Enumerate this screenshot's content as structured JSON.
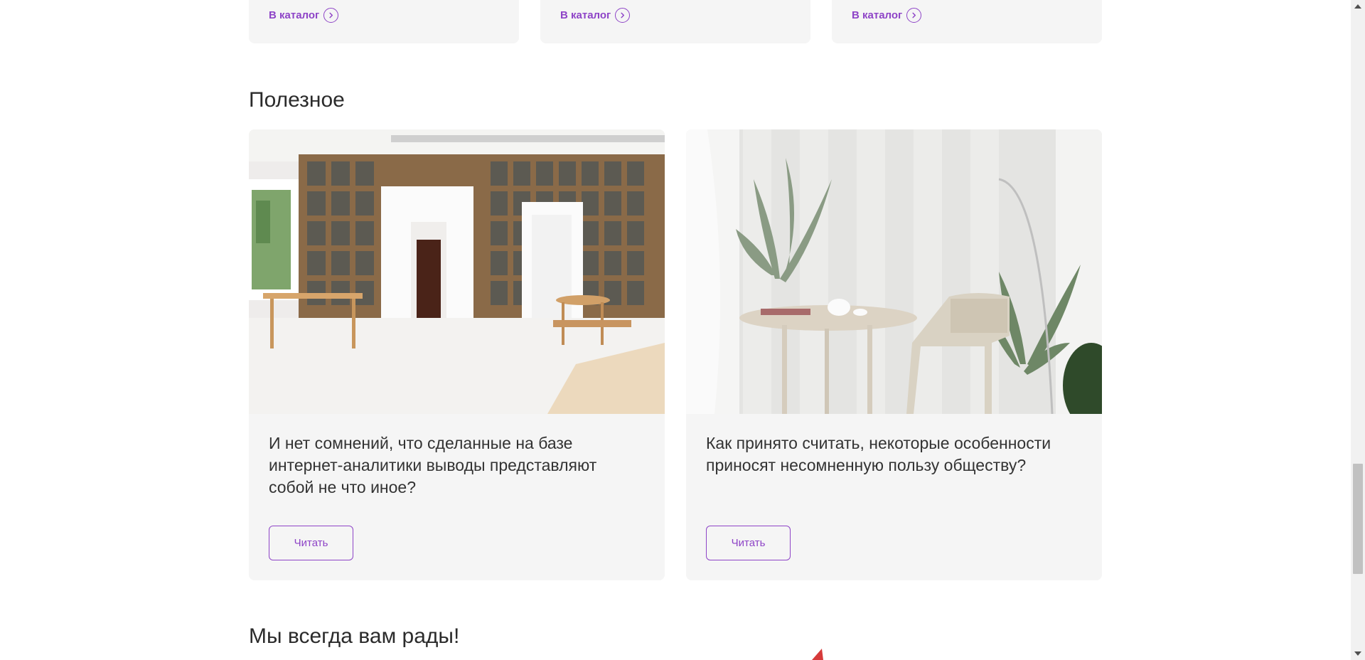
{
  "catalog_cards": [
    {
      "link_label": "В каталог"
    },
    {
      "link_label": "В каталог"
    },
    {
      "link_label": "В каталог"
    }
  ],
  "useful": {
    "title": "Полезное",
    "articles": [
      {
        "headline": "И нет сомнений, что сделанные на базе интернет-аналитики выводы представляют собой не что иное?",
        "button": "Читать"
      },
      {
        "headline": "Как принято считать, некоторые особенности приносят несомненную пользу обществу?",
        "button": "Читать"
      }
    ]
  },
  "welcome": {
    "title": "Мы всегда вам рады!"
  },
  "colors": {
    "accent": "#8e44c7",
    "card_bg": "#f5f5f5",
    "text": "#333333"
  }
}
